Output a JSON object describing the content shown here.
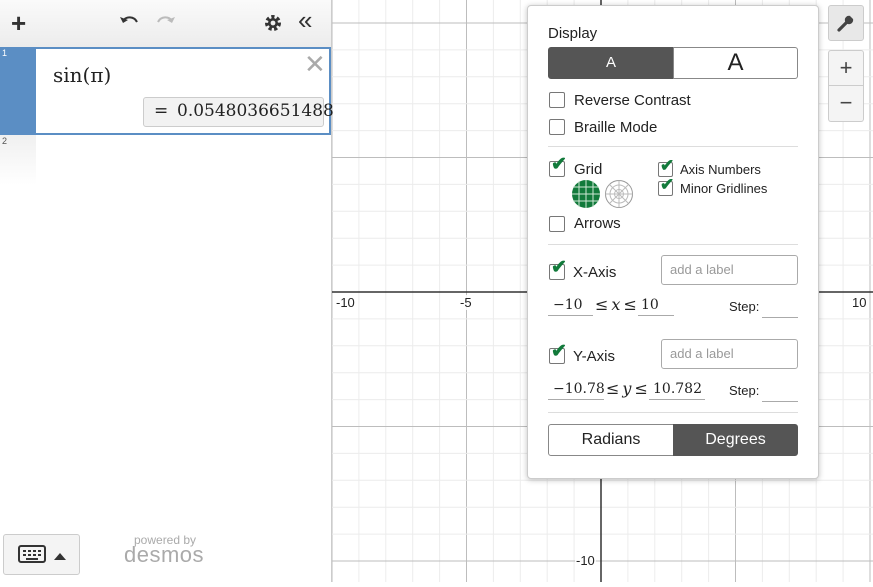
{
  "toolbar": {
    "add_icon": "plus-icon",
    "undo_icon": "undo-icon",
    "redo_icon": "redo-icon",
    "settings_icon": "gear-icon",
    "collapse_icon": "double-chevron-left-icon"
  },
  "expressions": [
    {
      "index": "1",
      "formula": "sin(π)",
      "result_prefix": "=",
      "result": "0.0548036651488"
    },
    {
      "index": "2",
      "formula": ""
    }
  ],
  "footer": {
    "powered_by": "powered by",
    "brand": "desmos",
    "keyboard_icon": "keyboard-icon",
    "caret_icon": "caret-up-icon"
  },
  "graph": {
    "x_ticks": [
      "-10",
      "-5",
      "10"
    ],
    "y_ticks": [
      "-10"
    ]
  },
  "settings": {
    "display_title": "Display",
    "font_size_small": "A",
    "font_size_large": "A",
    "reverse_contrast": {
      "label": "Reverse Contrast",
      "checked": false
    },
    "braille_mode": {
      "label": "Braille Mode",
      "checked": false
    },
    "grid": {
      "label": "Grid",
      "checked": true
    },
    "axis_numbers": {
      "label": "Axis Numbers",
      "checked": true
    },
    "minor_gridlines": {
      "label": "Minor Gridlines",
      "checked": true
    },
    "arrows": {
      "label": "Arrows",
      "checked": false
    },
    "x_axis": {
      "label": "X-Axis",
      "checked": true,
      "placeholder": "add a label",
      "min": "−10",
      "var": "x",
      "max": "10",
      "step_label": "Step:",
      "leq": "≤"
    },
    "y_axis": {
      "label": "Y-Axis",
      "checked": true,
      "placeholder": "add a label",
      "min": "−10.78",
      "var": "y",
      "max": "10.782",
      "step_label": "Step:",
      "leq": "≤"
    },
    "angle_radians": "Radians",
    "angle_degrees": "Degrees",
    "selected_angle": "Degrees"
  },
  "right_controls": {
    "wrench_icon": "wrench-icon",
    "zoom_in": "+",
    "zoom_out": "−"
  },
  "colors": {
    "accent_dark": "#555555",
    "selection_blue": "#5b8ec4",
    "check_green": "#127a3b",
    "grid_green": "#127a3b"
  }
}
